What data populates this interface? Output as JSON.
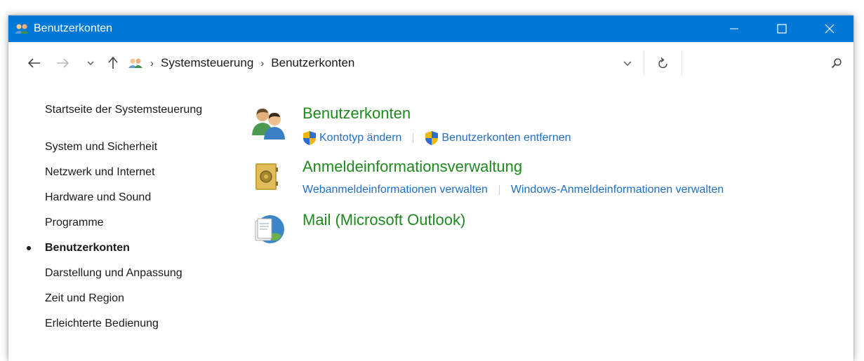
{
  "window": {
    "title": "Benutzerkonten",
    "controls": [
      "minimize",
      "maximize",
      "close"
    ]
  },
  "addressbar": {
    "breadcrumb": [
      "Systemsteuerung",
      "Benutzerkonten"
    ],
    "search_placeholder": "",
    "icons": [
      "back-arrow-icon",
      "forward-arrow-icon",
      "recent-dropdown-icon",
      "up-arrow-icon",
      "users-icon",
      "chevron-down-icon",
      "refresh-icon",
      "search-icon"
    ]
  },
  "sidebar": {
    "home_label": "Startseite der Systemsteuerung",
    "items": [
      {
        "label": "System und Sicherheit",
        "active": false
      },
      {
        "label": "Netzwerk und Internet",
        "active": false
      },
      {
        "label": "Hardware und Sound",
        "active": false
      },
      {
        "label": "Programme",
        "active": false
      },
      {
        "label": "Benutzerkonten",
        "active": true
      },
      {
        "label": "Darstellung und Anpassung",
        "active": false
      },
      {
        "label": "Zeit und Region",
        "active": false
      },
      {
        "label": "Erleichterte Bedienung",
        "active": false
      }
    ]
  },
  "main": {
    "groups": [
      {
        "title": "Benutzerkonten",
        "icon": "user-accounts-icon",
        "links": [
          {
            "label": "Kontotyp ändern",
            "shield": true
          },
          {
            "label": "Benutzerkonten entfernen",
            "shield": true
          }
        ]
      },
      {
        "title": "Anmeldeinformationsverwaltung",
        "icon": "credential-vault-icon",
        "links": [
          {
            "label": "Webanmeldeinformationen verwalten",
            "shield": false
          },
          {
            "label": "Windows-Anmeldeinformationen verwalten",
            "shield": false
          }
        ]
      },
      {
        "title": "Mail (Microsoft Outlook)",
        "icon": "mail-icon",
        "links": []
      }
    ]
  },
  "colors": {
    "titlebar": "#0078d7",
    "group_title": "#1e8a1e",
    "link": "#1f6fc5"
  }
}
